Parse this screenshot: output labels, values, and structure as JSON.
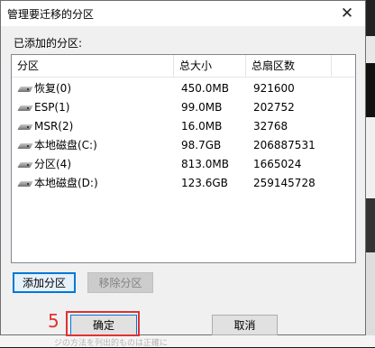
{
  "dialog": {
    "title": "管理要迁移的分区",
    "close_glyph": "✕",
    "section_label": "已添加的分区:"
  },
  "table": {
    "columns": [
      "分区",
      "总大小",
      "总扇区数"
    ],
    "rows": [
      {
        "name": "恢复(0)",
        "size": "450.0MB",
        "sectors": "921600",
        "icon": "drive-icon"
      },
      {
        "name": "ESP(1)",
        "size": "99.0MB",
        "sectors": "202752",
        "icon": "drive-icon"
      },
      {
        "name": "MSR(2)",
        "size": "16.0MB",
        "sectors": "32768",
        "icon": "drive-icon"
      },
      {
        "name": "本地磁盘(C:)",
        "size": "98.7GB",
        "sectors": "206887531",
        "icon": "drive-icon"
      },
      {
        "name": "分区(4)",
        "size": "813.0MB",
        "sectors": "1665024",
        "icon": "drive-icon"
      },
      {
        "name": "本地磁盘(D:)",
        "size": "123.6GB",
        "sectors": "259145728",
        "icon": "drive-icon"
      }
    ]
  },
  "buttons": {
    "add_partition": "添加分区",
    "remove_partition": "移除分区",
    "ok": "确定",
    "cancel": "取消"
  },
  "annotation": {
    "step_number": "5",
    "color": "#e03131"
  },
  "background": {
    "bottom_text": "ジの方法を列出的ものは正確に"
  }
}
